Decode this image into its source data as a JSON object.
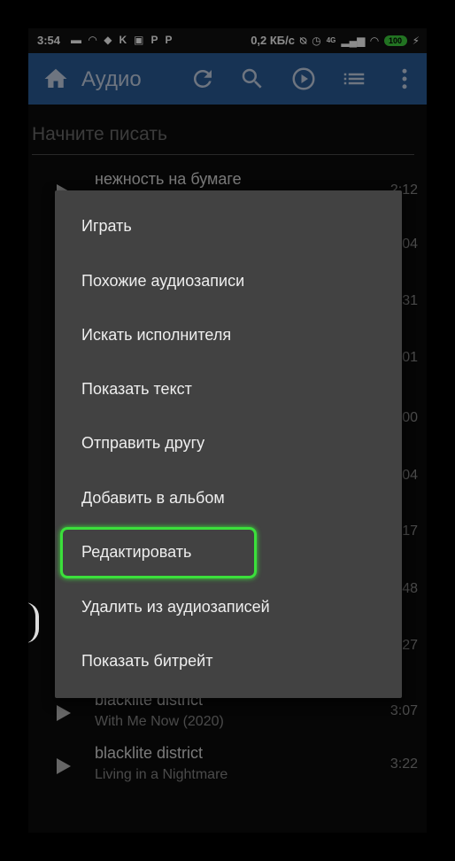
{
  "status_bar": {
    "time": "3:54",
    "left_icons": [
      "message-icon",
      "wifi-icon",
      "vpn-icon",
      "k-icon",
      "vk-icon",
      "p-icon",
      "p-icon"
    ],
    "network_speed": "0,2 КБ/с",
    "network_type": "4G",
    "battery": "100"
  },
  "app_bar": {
    "title": "Аудио",
    "color": "#2a5d9a",
    "icons": [
      "home-icon",
      "refresh-icon",
      "search-icon",
      "play-circle-icon",
      "list-icon",
      "more-vert-icon"
    ]
  },
  "search": {
    "placeholder": "Начните писать"
  },
  "tracks": [
    {
      "title": "нежность на бумаге",
      "artist": "",
      "duration": "2:12"
    },
    {
      "title": "",
      "artist": "",
      "duration": "04"
    },
    {
      "title": "",
      "artist": "",
      "duration": "31"
    },
    {
      "title": "",
      "artist": "",
      "duration": "01"
    },
    {
      "title": "",
      "artist": "",
      "duration": "00"
    },
    {
      "title": "",
      "artist": "",
      "duration": "04"
    },
    {
      "title": "",
      "artist": "",
      "duration": "17"
    },
    {
      "title": "",
      "artist": "",
      "duration": "48"
    },
    {
      "title": "",
      "artist": "",
      "duration": "27"
    },
    {
      "title": "blacklite district",
      "artist": "With Me Now (2020)",
      "duration": "3:07"
    },
    {
      "title": "blacklite district",
      "artist": "Living in a Nightmare",
      "duration": "3:22"
    }
  ],
  "context_menu": {
    "items": [
      "Играть",
      "Похожие аудиозаписи",
      "Искать исполнителя",
      "Показать текст",
      "Отправить другу",
      "Добавить в альбом",
      "Редактировать",
      "Удалить из аудиозаписей",
      "Показать битрейт"
    ],
    "highlighted_item": "Редактировать",
    "highlight_color": "#3be03b"
  }
}
